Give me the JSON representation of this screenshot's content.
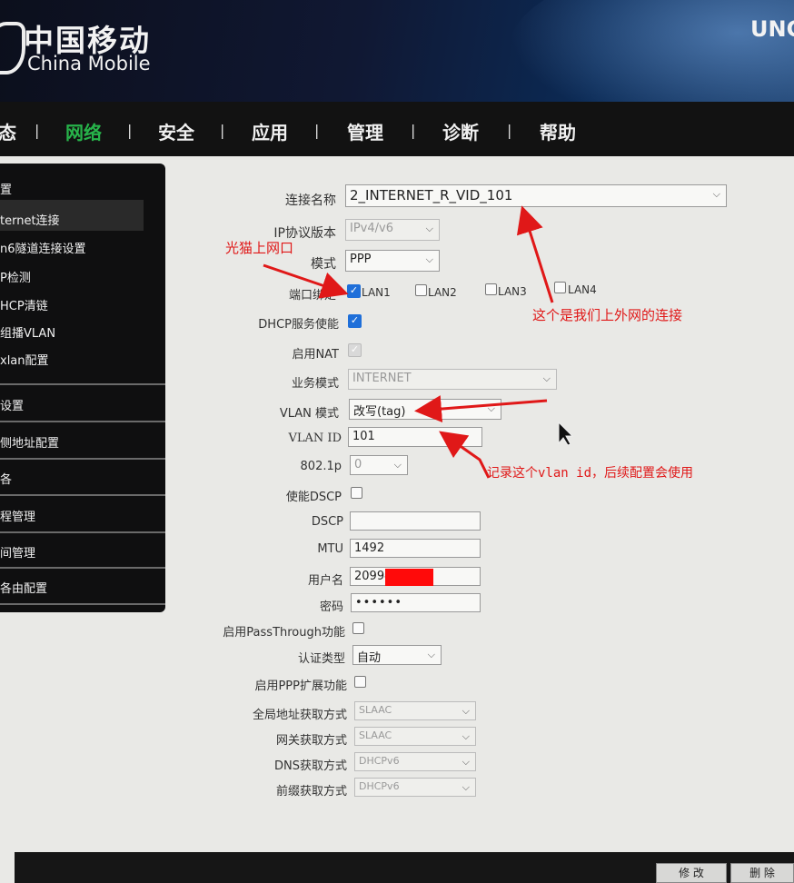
{
  "header": {
    "logo_cn": "中国移动",
    "logo_en": "China Mobile",
    "brand_right": "UNC"
  },
  "nav": {
    "items": [
      "态",
      "网络",
      "安全",
      "应用",
      "管理",
      "诊断",
      "帮助"
    ],
    "separator": "|",
    "active": "网络"
  },
  "sidebar": {
    "items": [
      "置",
      "ternet连接",
      "n6隧道连接设置",
      "P检测",
      "HCP清链",
      "组播VLAN",
      "xlan配置",
      "设置",
      "侧地址配置",
      "各",
      "程管理",
      "间管理",
      "各由配置"
    ]
  },
  "form": {
    "conn_name": {
      "label": "连接名称",
      "value": "2_INTERNET_R_VID_101"
    },
    "ip_version": {
      "label": "IP协议版本",
      "value": "IPv4/v6"
    },
    "mode": {
      "label": "模式",
      "value": "PPP"
    },
    "port_binding": {
      "label": "端口绑定",
      "ports": [
        {
          "name": "LAN1",
          "checked": true
        },
        {
          "name": "LAN2",
          "checked": false
        },
        {
          "name": "LAN3",
          "checked": false
        },
        {
          "name": "LAN4",
          "checked": false
        }
      ]
    },
    "dhcp": {
      "label": "DHCP服务使能",
      "checked": true
    },
    "nat": {
      "label": "启用NAT",
      "checked": true
    },
    "service_mode": {
      "label": "业务模式",
      "value": "INTERNET"
    },
    "vlan_mode": {
      "label": "VLAN 模式",
      "value": "改写(tag)"
    },
    "vlan_id": {
      "label": "VLAN ID",
      "value": "101"
    },
    "dot1p": {
      "label": "802.1p",
      "value": "0"
    },
    "dscp_enable": {
      "label": "使能DSCP",
      "checked": false
    },
    "dscp": {
      "label": "DSCP",
      "value": ""
    },
    "mtu": {
      "label": "MTU",
      "value": "1492"
    },
    "username": {
      "label": "用户名",
      "value": "20994"
    },
    "password": {
      "label": "密码",
      "value": "••••••"
    },
    "passthrough": {
      "label": "启用PassThrough功能",
      "checked": false
    },
    "auth_type": {
      "label": "认证类型",
      "value": "自动"
    },
    "ppp_ext": {
      "label": "启用PPP扩展功能",
      "checked": false
    },
    "global_addr": {
      "label": "全局地址获取方式",
      "value": "SLAAC"
    },
    "gateway": {
      "label": "网关获取方式",
      "value": "SLAAC"
    },
    "dns": {
      "label": "DNS获取方式",
      "value": "DHCPv6"
    },
    "prefix": {
      "label": "前缀获取方式",
      "value": "DHCPv6"
    }
  },
  "annotations": {
    "uplink": "光猫上网口",
    "internet_conn": "这个是我们上外网的连接",
    "vlan_note": "记录这个vlan id，后续配置会使用"
  },
  "footer": {
    "modify": "修 改",
    "delete": "删 除"
  },
  "colors": {
    "annotation": "#e01818",
    "checkbox": "#1f6fd9",
    "redaction": "#ff0a0a"
  }
}
